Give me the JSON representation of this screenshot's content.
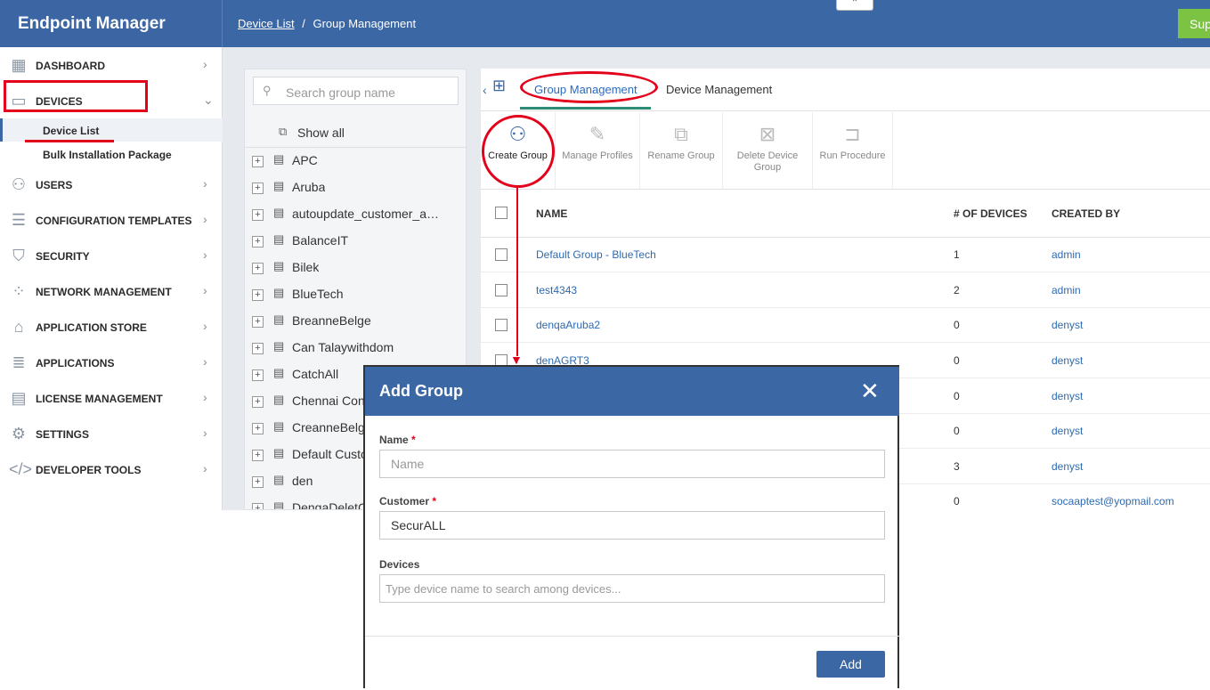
{
  "app": {
    "title": "Endpoint Manager",
    "support_label": "Support"
  },
  "breadcrumb": {
    "parent": "Device List",
    "separator": "/",
    "current": "Group Management"
  },
  "sidebar": {
    "items": [
      {
        "label": "DASHBOARD",
        "icon": "dashboard-icon"
      },
      {
        "label": "DEVICES",
        "icon": "devices-icon"
      },
      {
        "label": "USERS",
        "icon": "user-icon"
      },
      {
        "label": "CONFIGURATION TEMPLATES",
        "icon": "templates-icon"
      },
      {
        "label": "SECURITY",
        "icon": "shield-icon"
      },
      {
        "label": "NETWORK MANAGEMENT",
        "icon": "network-icon"
      },
      {
        "label": "APPLICATION STORE",
        "icon": "store-icon"
      },
      {
        "label": "APPLICATIONS",
        "icon": "applications-icon"
      },
      {
        "label": "LICENSE MANAGEMENT",
        "icon": "license-icon"
      },
      {
        "label": "SETTINGS",
        "icon": "gear-icon"
      },
      {
        "label": "DEVELOPER TOOLS",
        "icon": "code-icon"
      }
    ],
    "sub_items": [
      "Device List",
      "Bulk Installation Package"
    ]
  },
  "tree": {
    "search_placeholder": "Search group name",
    "show_all": "Show all",
    "groups": [
      "APC",
      "Aruba",
      "autoupdate_customer_a…",
      "BalanceIT",
      "Bilek",
      "BlueTech",
      "BreanneBelge",
      "Can Talaywithdom",
      "CatchAll",
      "Chennai Con",
      "CreanneBelg",
      "Default Custo",
      "den",
      "DengaDeletC"
    ]
  },
  "tabs": [
    "Group Management",
    "Device Management"
  ],
  "toolbar": [
    "Create Group",
    "Manage Profiles",
    "Rename Group",
    "Delete Device Group",
    "Run Procedure"
  ],
  "table": {
    "headers": {
      "name": "NAME",
      "devices": "# OF DEVICES",
      "created_by": "CREATED BY"
    },
    "rows": [
      {
        "name": "Default Group - BlueTech",
        "devices": "1",
        "created_by": "admin"
      },
      {
        "name": "test4343",
        "devices": "2",
        "created_by": "admin"
      },
      {
        "name": "denqaAruba2",
        "devices": "0",
        "created_by": "denyst"
      },
      {
        "name": "denAGRT3",
        "devices": "0",
        "created_by": "denyst"
      },
      {
        "name": "",
        "devices": "0",
        "created_by": "denyst"
      },
      {
        "name": "",
        "devices": "0",
        "created_by": "denyst"
      },
      {
        "name": "",
        "devices": "3",
        "created_by": "denyst"
      },
      {
        "name": "",
        "devices": "0",
        "created_by": "socaaptest@yopmail.com"
      }
    ]
  },
  "modal": {
    "title": "Add Group",
    "close_icon": "close-icon",
    "name_label": "Name",
    "name_placeholder": "Name",
    "customer_label": "Customer",
    "customer_value": "SecurALL",
    "devices_label": "Devices",
    "devices_placeholder": "Type device name to search among devices...",
    "required_mark": "*",
    "add_label": "Add"
  },
  "colors": {
    "brand": "#3c67a5",
    "annotation_red": "#e3001b",
    "support_green": "#7cc243",
    "tab_underline": "#2e8b75"
  }
}
